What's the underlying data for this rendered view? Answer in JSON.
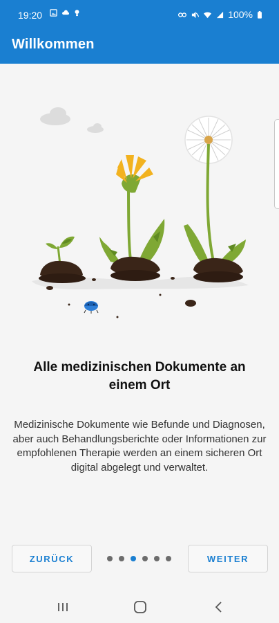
{
  "status_bar": {
    "time": "19:20",
    "battery": "100%"
  },
  "app_bar": {
    "title": "Willkommen"
  },
  "onboarding": {
    "heading": "Alle medizinischen Dokumente an einem Ort",
    "description": "Medizinische Dokumente wie Befunde und Diagnosen, aber auch Behandlungsberichte oder Informationen zur empfohlenen Therapie werden an einem sicheren Ort digital abgelegt und verwaltet.",
    "page_count": 6,
    "active_page": 3
  },
  "buttons": {
    "back_label": "ZURÜCK",
    "next_label": "WEITER"
  },
  "colors": {
    "primary": "#1a7fd1",
    "background": "#f5f5f5",
    "dot_inactive": "#6c6c6c"
  },
  "icons": {
    "status": [
      "gallery-icon",
      "cloud-icon",
      "bulb-icon",
      "key-icon",
      "mute-icon",
      "wifi-icon",
      "signal-icon",
      "battery-icon"
    ],
    "nav": [
      "recents-icon",
      "home-icon",
      "back-icon"
    ]
  }
}
